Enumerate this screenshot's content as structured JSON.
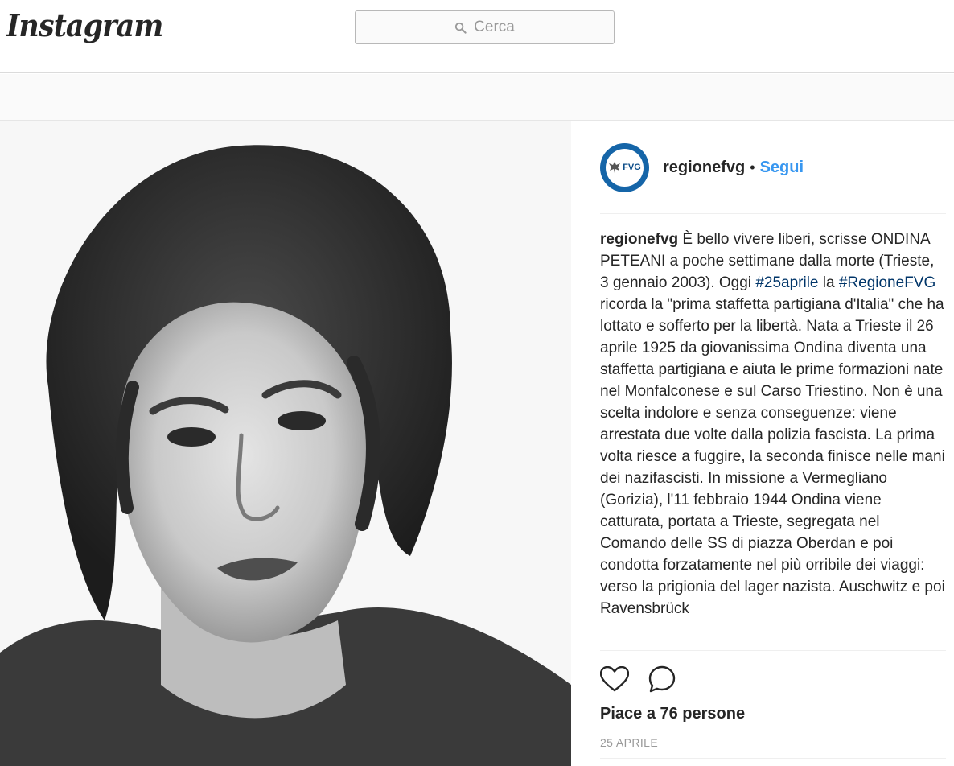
{
  "header": {
    "logo_text": "Instagram",
    "search_placeholder": "Cerca",
    "search_icon": "search-icon"
  },
  "post": {
    "username": "regionefvg",
    "avatar_text": "FVG",
    "follow_label": "Segui",
    "separator": "•",
    "caption": {
      "user": "regionefvg",
      "text_before": " È bello vivere liberi, scrisse ONDINA PETEANI a poche settimane dalla morte (Trieste, 3 gennaio 2003). Oggi ",
      "hashtag1": "#25aprile",
      "text_mid": " la ",
      "hashtag2": "#RegioneFVG",
      "text_after": " ricorda la \"prima staffetta partigiana d'Italia\" che ha lottato e sofferto per la libertà. Nata a Trieste il 26 aprile 1925 da giovanissima Ondina diventa una staffetta partigiana e aiuta le prime formazioni nate nel Monfalconese e sul Carso Triestino. Non è una scelta indolore e senza conseguenze: viene arrestata due volte dalla polizia fascista. La prima volta riesce a fuggire, la seconda finisce nelle mani dei nazifascisti. In missione a Vermegliano (Gorizia), l'11 febbraio 1944 Ondina viene catturata, portata a Trieste, segregata nel Comando delle SS di piazza Oberdan e poi condotta forzatamente nel più orribile dei viaggi: verso la prigionia del lager nazista. Auschwitz e poi Ravensbrück"
    },
    "likes_text": "Piace a 76 persone",
    "date_text": "25 APRILE",
    "icons": {
      "like": "heart-icon",
      "comment": "comment-icon"
    },
    "colors": {
      "link": "#3897f0",
      "hashtag": "#003569",
      "avatar_ring": "#1565a8"
    }
  }
}
